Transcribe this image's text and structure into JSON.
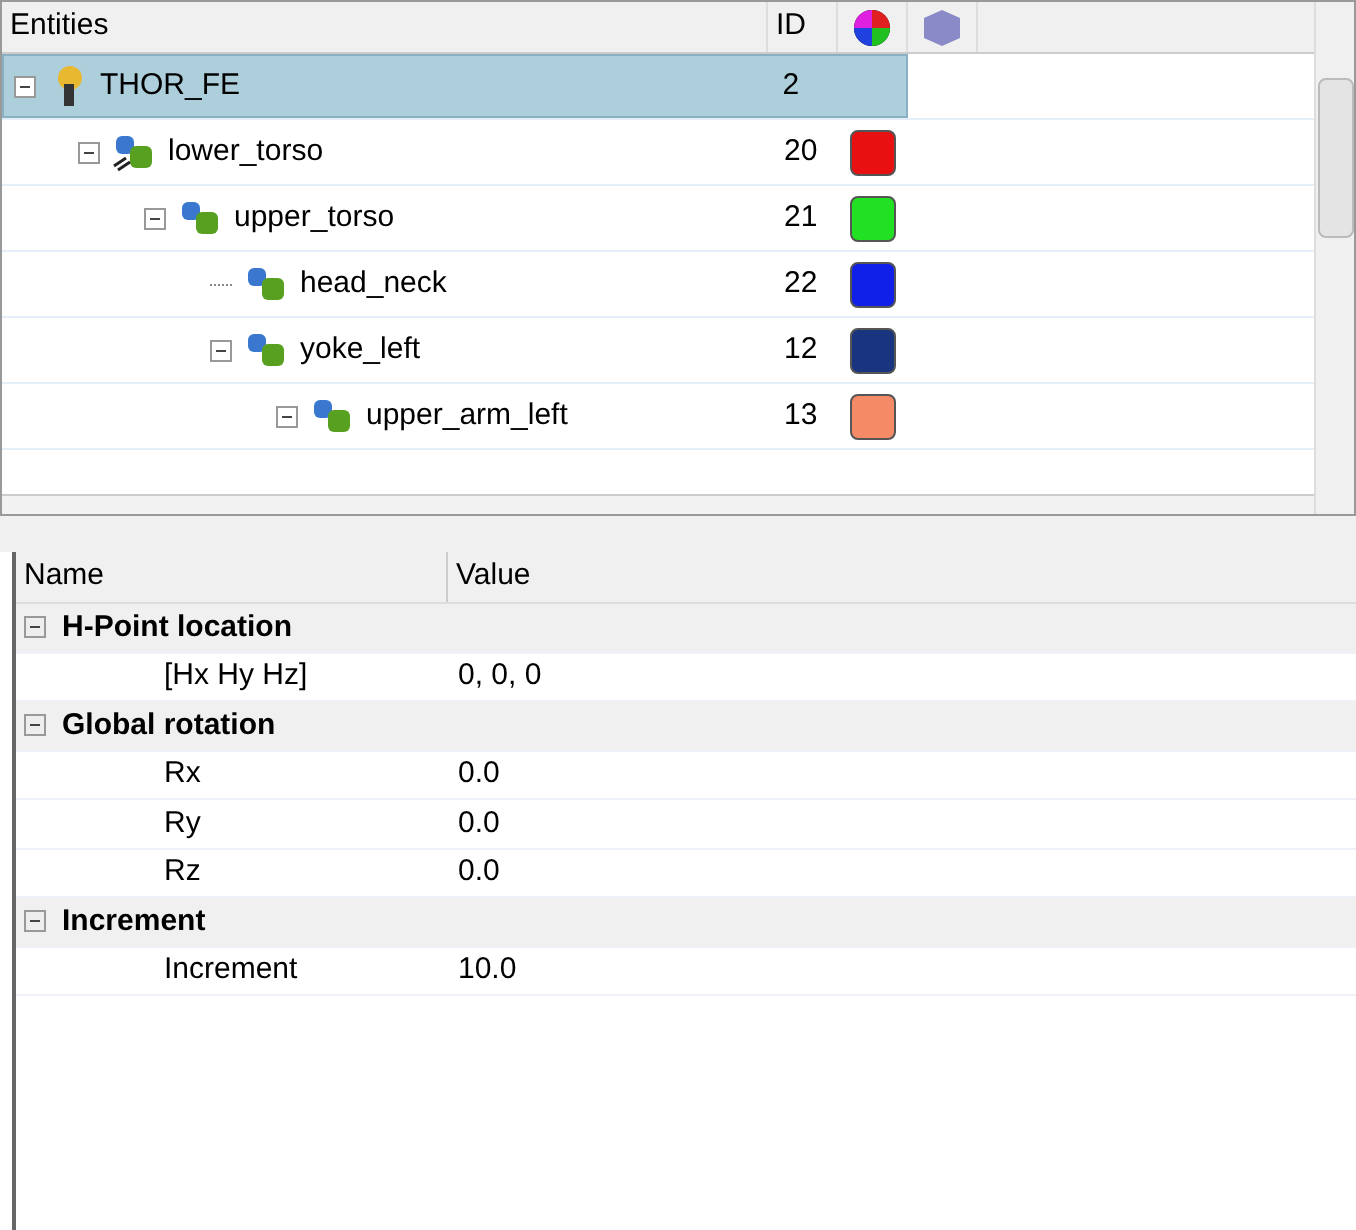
{
  "tree": {
    "columns": [
      "Entities",
      "ID"
    ],
    "items": [
      {
        "name": "THOR_FE",
        "id": "2",
        "kind": "model",
        "selected": true,
        "expanded": true,
        "children": [
          {
            "name": "lower_torso",
            "id": "20",
            "kind": "assembly",
            "color": "#e81010",
            "selected": false,
            "expanded": true,
            "children": [
              {
                "name": "upper_torso",
                "id": "21",
                "kind": "component",
                "color": "#22e022",
                "selected": false,
                "expanded": true,
                "children": [
                  {
                    "name": "head_neck",
                    "id": "22",
                    "kind": "component",
                    "color": "#1020e8",
                    "selected": false
                  },
                  {
                    "name": "yoke_left",
                    "id": "12",
                    "kind": "component",
                    "color": "#1a3580",
                    "selected": false,
                    "expanded": true,
                    "children": [
                      {
                        "name": "upper_arm_left",
                        "id": "13",
                        "kind": "component",
                        "color": "#f58a66",
                        "selected": false,
                        "expanded": true
                      }
                    ]
                  }
                ]
              }
            ]
          }
        ]
      }
    ]
  },
  "properties": {
    "columns": [
      "Name",
      "Value"
    ],
    "groups": [
      {
        "title": "H-Point location",
        "expanded": true,
        "rows": [
          {
            "name": "[Hx Hy Hz]",
            "value": "0, 0, 0"
          }
        ]
      },
      {
        "title": "Global rotation",
        "expanded": true,
        "rows": [
          {
            "name": "Rx",
            "value": "0.0"
          },
          {
            "name": "Ry",
            "value": "0.0"
          },
          {
            "name": "Rz",
            "value": "0.0"
          }
        ]
      },
      {
        "title": "Increment",
        "expanded": true,
        "rows": [
          {
            "name": "Increment",
            "value": "10.0"
          }
        ]
      }
    ]
  }
}
